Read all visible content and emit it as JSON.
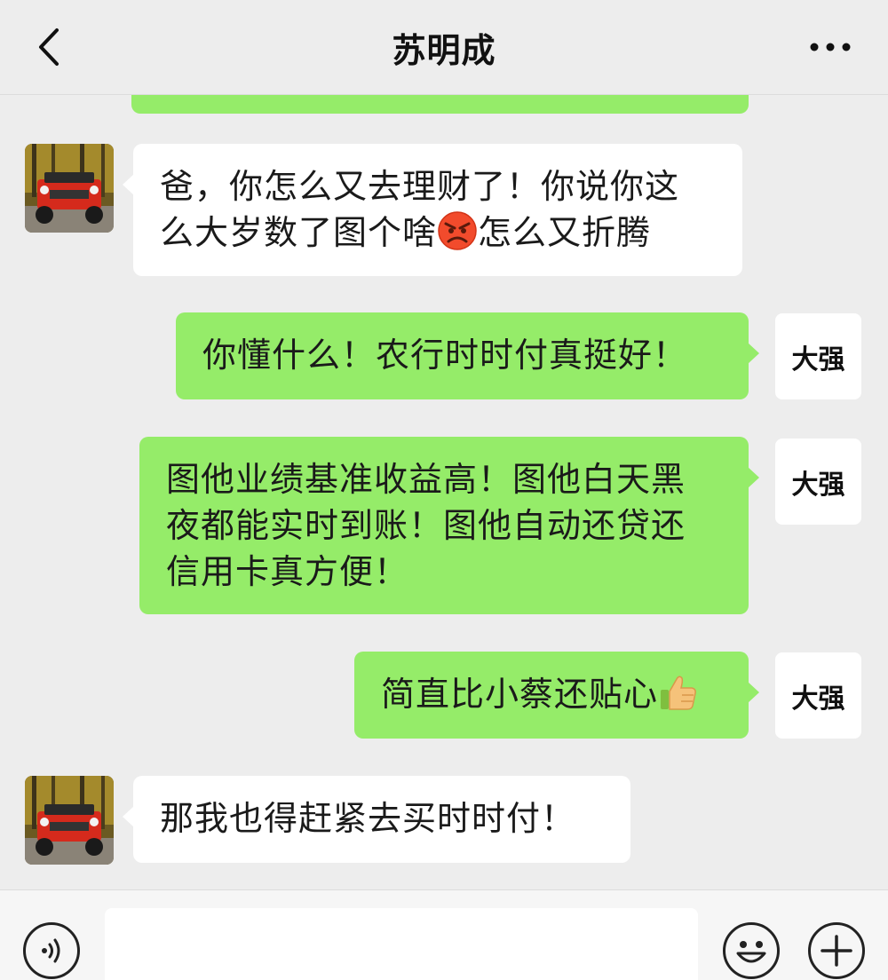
{
  "header": {
    "title": "苏明成",
    "back_icon": "chevron-left-icon",
    "more_icon": "more-dots-icon"
  },
  "messages": [
    {
      "side": "in",
      "sender": "jeep-avatar",
      "text_a": "爸，你怎么又去理财了！你说你这",
      "text_b": "么大岁数了图个啥",
      "emoji": "angry-face",
      "text_c": "怎么又折腾"
    },
    {
      "side": "out",
      "sender": "大强",
      "text": "你懂什么！农行时时付真挺好！"
    },
    {
      "side": "out",
      "sender": "大强",
      "text_a": "图他业绩基准收益高！图他白天黑",
      "text_b": "夜都能实时到账！图他自动还贷还",
      "text_c": "信用卡真方便！"
    },
    {
      "side": "out",
      "sender": "大强",
      "text": "简直比小蔡还贴心",
      "emoji": "thumbs-up"
    },
    {
      "side": "in",
      "sender": "jeep-avatar",
      "text": "那我也得赶紧去买时时付！"
    }
  ],
  "input": {
    "value": "",
    "voice_icon": "voice-icon",
    "emoji_icon": "smiley-icon",
    "plus_icon": "plus-icon"
  },
  "colors": {
    "background": "#ededed",
    "outgoing_bubble": "#95ec69",
    "incoming_bubble": "#ffffff"
  }
}
